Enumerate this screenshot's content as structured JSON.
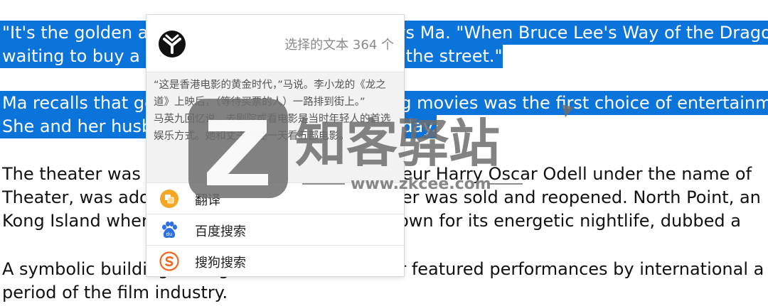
{
  "article": {
    "line1": "\"It's the golden age of Hong Kong cinema,\" says Ma. \"When Bruce Lee's Way of the Dragon",
    "line2": "waiting to buy a ticket stretched all the way to the street.\"",
    "line3": "Ma recalls that going to the theater or watching movies was the first choice of entertainment",
    "line4": "She and her husband would watch five films a day.",
    "line5": "The theater was founded in 1959 by entrepreneur Harry Oscar Odell under the name of",
    "line6": "Theater, was adopted when the building's owner was sold and reopened. North Point, an",
    "line7": "Kong Island where the theater is located, is known for its energetic nightlife, dubbed a",
    "line8": "A symbolic building during this era, the theater featured performances by international a",
    "line9": "period of the film industry."
  },
  "popup": {
    "count_label": "选择的文本 364 个",
    "preview": "“这是香港电影的黄金时代，”马说。李小龙的《龙之道》上映后，（等待买票的人）一路排到街上。”\n马英九回忆说，去剧院或看电影是当时年轻人的首选娱乐方式。她和丈夫曾经一天看五部电影。",
    "menu": [
      {
        "label": "翻译",
        "icon": "translate-icon",
        "color": "#f5a623"
      },
      {
        "label": "百度搜索",
        "icon": "baidu-icon",
        "color": "#2f6fe4"
      },
      {
        "label": "搜狗搜索",
        "icon": "sogou-icon",
        "color": "#f26522"
      }
    ]
  },
  "watermark": {
    "brand": "知客驿站",
    "url": "www.zkcee.com"
  },
  "colors": {
    "selection": "#0a74da",
    "watermark": "#7a7a7a"
  }
}
